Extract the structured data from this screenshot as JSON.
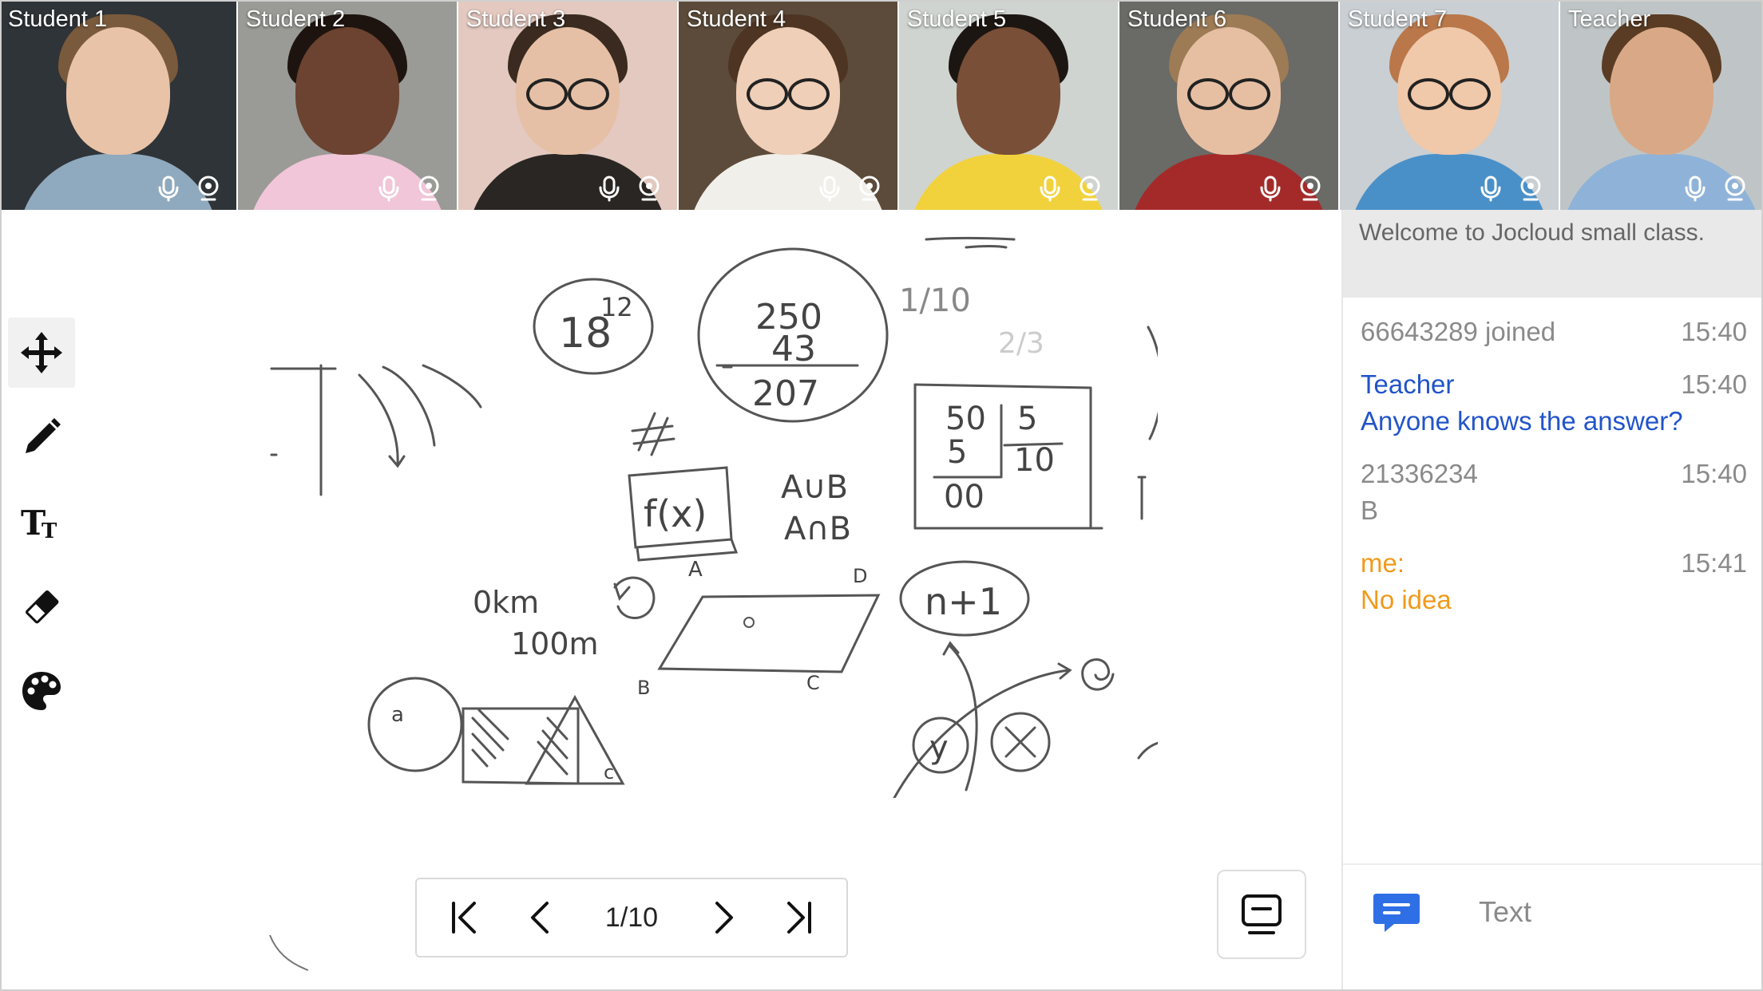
{
  "video_tiles": [
    {
      "name": "Student 1",
      "bg": "#2f3438",
      "skin": "#e8c3a8",
      "hair": "#7a5a3c",
      "shirt": "#8fa9be",
      "glasses": false
    },
    {
      "name": "Student 2",
      "bg": "#9a9a96",
      "skin": "#6b4330",
      "hair": "#1e140f",
      "shirt": "#f0c6d8",
      "glasses": false
    },
    {
      "name": "Student 3",
      "bg": "#e3c9c0",
      "skin": "#e6c0a6",
      "hair": "#3a2a20",
      "shirt": "#2a2623",
      "glasses": true
    },
    {
      "name": "Student 4",
      "bg": "#5c4b3a",
      "skin": "#efcfb8",
      "hair": "#4e3422",
      "shirt": "#f0efea",
      "glasses": true
    },
    {
      "name": "Student 5",
      "bg": "#cfd4d0",
      "skin": "#7a4f37",
      "hair": "#1c1612",
      "shirt": "#f2d23c",
      "glasses": false
    },
    {
      "name": "Student 6",
      "bg": "#6a6a66",
      "skin": "#e6bfa3",
      "hair": "#9c7b55",
      "shirt": "#a42a2a",
      "glasses": true
    },
    {
      "name": "Student 7",
      "bg": "#c9cfd3",
      "skin": "#f0c8aa",
      "hair": "#b9774a",
      "shirt": "#4a90c8",
      "glasses": true
    },
    {
      "name": "Teacher",
      "bg": "#bfc5c6",
      "skin": "#d9a987",
      "hair": "#5a3c24",
      "shirt": "#8fb3d8",
      "glasses": false
    }
  ],
  "whiteboard": {
    "t1": "18",
    "t1sup": "12",
    "t2": "250",
    "t3": "43",
    "t4": "207",
    "t5": "1/10",
    "t6": "2/3",
    "t7": "50",
    "t8": "5",
    "t9": "5",
    "t10": "10",
    "t11": "00",
    "t12": "f(x)",
    "t13": "A∪B",
    "t14": "A∩B",
    "t15": "0km",
    "t16": "100m",
    "t17": "A",
    "t18": "D",
    "t19": "B",
    "t20": "C",
    "t21": "n+1",
    "t22": "a",
    "t23": "c",
    "t24": "y",
    "t25": "x",
    "t26": "#"
  },
  "pager": {
    "indicator": "1/10"
  },
  "chat": {
    "announcement": "Welcome to Jocloud small class.",
    "messages": [
      {
        "type": "system",
        "who": "66643289  joined",
        "time": "15:40",
        "text": ""
      },
      {
        "type": "teacher",
        "who": "Teacher",
        "time": "15:40",
        "text": "Anyone knows the answer?"
      },
      {
        "type": "student",
        "who": "21336234",
        "time": "15:40",
        "text": "B"
      },
      {
        "type": "me",
        "who": "me:",
        "time": "15:41",
        "text": "No idea"
      }
    ],
    "input_placeholder": "Text"
  },
  "colors": {
    "accent": "#2f6fe6",
    "teacher": "#2154c9",
    "me": "#f09a1c",
    "muted": "#8a8a8a"
  }
}
